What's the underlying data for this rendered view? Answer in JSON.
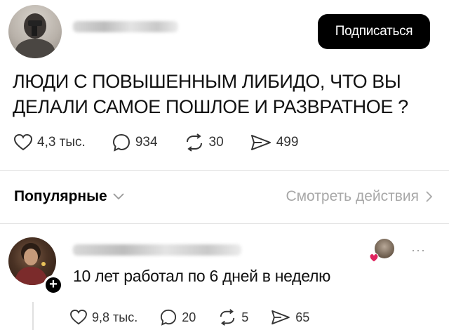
{
  "header": {
    "subscribe_label": "Подписаться"
  },
  "post": {
    "text_line1": "ЛЮДИ С ПОВЫШЕННЫМ ЛИБИДО, ЧТО ВЫ",
    "text_line2": "ДЕЛАЛИ САМОЕ ПОШЛОЕ И РАЗВРАТНОЕ ?",
    "likes": "4,3 тыс.",
    "comments": "934",
    "reposts": "30",
    "shares": "499"
  },
  "sort_bar": {
    "sort_label": "Популярные",
    "activity_label": "Смотреть действия"
  },
  "comment": {
    "text": "10 лет работал по 6 дней в неделю",
    "likes": "9,8 тыс.",
    "replies": "20",
    "reposts": "5",
    "shares": "65",
    "more_glyph": "···"
  },
  "colors": {
    "accent": "#000000",
    "muted": "#a8a8a8",
    "heart": "#e0245e"
  }
}
